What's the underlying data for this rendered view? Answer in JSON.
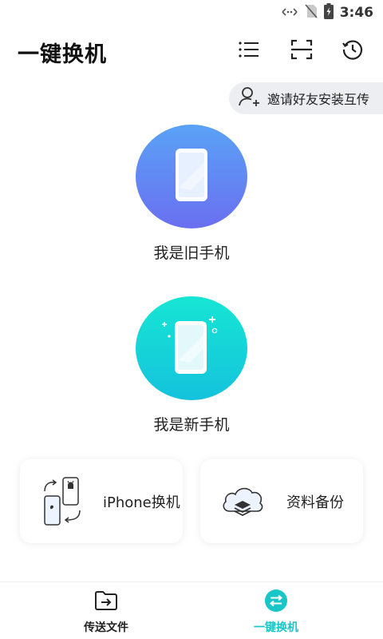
{
  "status_bar": {
    "time": "3:46",
    "icons": [
      "data-transfer-icon",
      "no-sim-icon",
      "battery-charging-icon"
    ]
  },
  "header": {
    "title": "一键换机",
    "icons": [
      "list-icon",
      "scan-icon",
      "history-icon"
    ]
  },
  "invite": {
    "label": "邀请好友安装互传",
    "icon": "add-user-icon"
  },
  "roles": {
    "old_phone": {
      "label": "我是旧手机",
      "icon": "phone-icon"
    },
    "new_phone": {
      "label": "我是新手机",
      "icon": "phone-sparkle-icon"
    }
  },
  "cards": {
    "iphone": {
      "label": "iPhone换机",
      "icon": "iphone-android-icon"
    },
    "backup": {
      "label": "资料备份",
      "icon": "cloud-layers-icon"
    }
  },
  "bottom_nav": {
    "files": {
      "label": "传送文件",
      "icon": "folder-send-icon"
    },
    "switch": {
      "label": "一键换机",
      "icon": "switch-icon",
      "active": true
    }
  },
  "colors": {
    "accent": "#17c6c7",
    "old_circle_top": "#5aa2f6",
    "old_circle_bottom": "#6a6ff0",
    "new_circle_top": "#17e6d4",
    "new_circle_bottom": "#14c2dc"
  }
}
